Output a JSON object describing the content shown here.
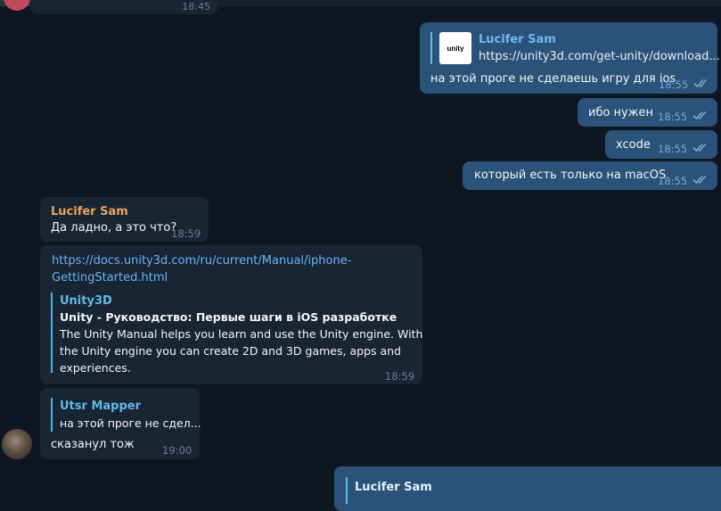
{
  "top_remnant": {
    "time": "18:45"
  },
  "messages": [
    {
      "id": "m1",
      "direction": "out",
      "reply": {
        "author": "Lucifer Sam",
        "text": "https://unity3d.com/get-unity/download..."
      },
      "thumb_label": "unity",
      "text": "на этой проге не сделаешь игру для ios",
      "time": "18:55",
      "read": true
    },
    {
      "id": "m2",
      "direction": "out",
      "text": "ибо нужен",
      "time": "18:55",
      "read": true
    },
    {
      "id": "m3",
      "direction": "out",
      "text": "xcode",
      "time": "18:55",
      "read": true
    },
    {
      "id": "m4",
      "direction": "out",
      "text": "который есть только на macOS",
      "time": "18:55",
      "read": true
    },
    {
      "id": "m5",
      "direction": "in",
      "author": "Lucifer Sam",
      "text": "Да ладно, а это что?",
      "time": "18:59"
    },
    {
      "id": "m6",
      "direction": "in",
      "link_lines": [
        "https://docs.unity3d.com/ru/current/Manual/iphone-",
        "GettingStarted.html"
      ],
      "preview": {
        "site": "Unity3D",
        "title": "Unity - Руководство: Первые шаги в iOS разработке",
        "desc_lines": [
          "The Unity Manual helps you learn and use the Unity engine. With",
          "the Unity engine you can create 2D and 3D games, apps and",
          "experiences."
        ]
      },
      "time": "18:59"
    },
    {
      "id": "m7",
      "direction": "in",
      "reply": {
        "author": "Utsr Mapper",
        "text": "на этой проге не сдел..."
      },
      "text": "сказанул тож",
      "time": "19:00"
    },
    {
      "id": "m8",
      "direction": "out",
      "reply": {
        "author": "Lucifer Sam"
      }
    }
  ],
  "colors": {
    "background": "#0e1621",
    "outgoing_bubble": "#2b5278",
    "incoming_bubble": "#182533",
    "link": "#6ab3f3",
    "name_orange": "#e8a35e",
    "checkmark": "#7da8d3"
  }
}
